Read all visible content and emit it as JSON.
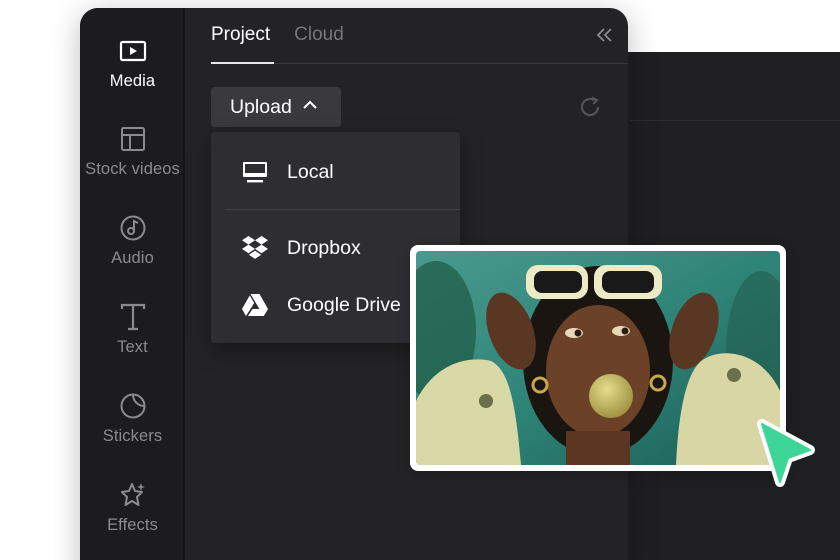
{
  "sidebar": {
    "items": [
      {
        "label": "Media",
        "icon": "media-icon",
        "active": true
      },
      {
        "label": "Stock videos",
        "icon": "stock-videos-icon",
        "active": false
      },
      {
        "label": "Audio",
        "icon": "audio-icon",
        "active": false
      },
      {
        "label": "Text",
        "icon": "text-icon",
        "active": false
      },
      {
        "label": "Stickers",
        "icon": "stickers-icon",
        "active": false
      },
      {
        "label": "Effects",
        "icon": "effects-icon",
        "active": false
      }
    ]
  },
  "tabs": [
    {
      "label": "Project",
      "active": true
    },
    {
      "label": "Cloud",
      "active": false
    }
  ],
  "upload": {
    "label": "Upload",
    "menu": [
      {
        "label": "Local",
        "icon": "monitor-icon"
      },
      {
        "label": "Dropbox",
        "icon": "dropbox-icon"
      },
      {
        "label": "Google Drive",
        "icon": "google-drive-icon"
      }
    ]
  },
  "colors": {
    "window_bg": "#232325",
    "sidebar_bg": "#1c1c1e",
    "menu_bg": "#2e2e31",
    "cursor_accent": "#3ed598"
  }
}
